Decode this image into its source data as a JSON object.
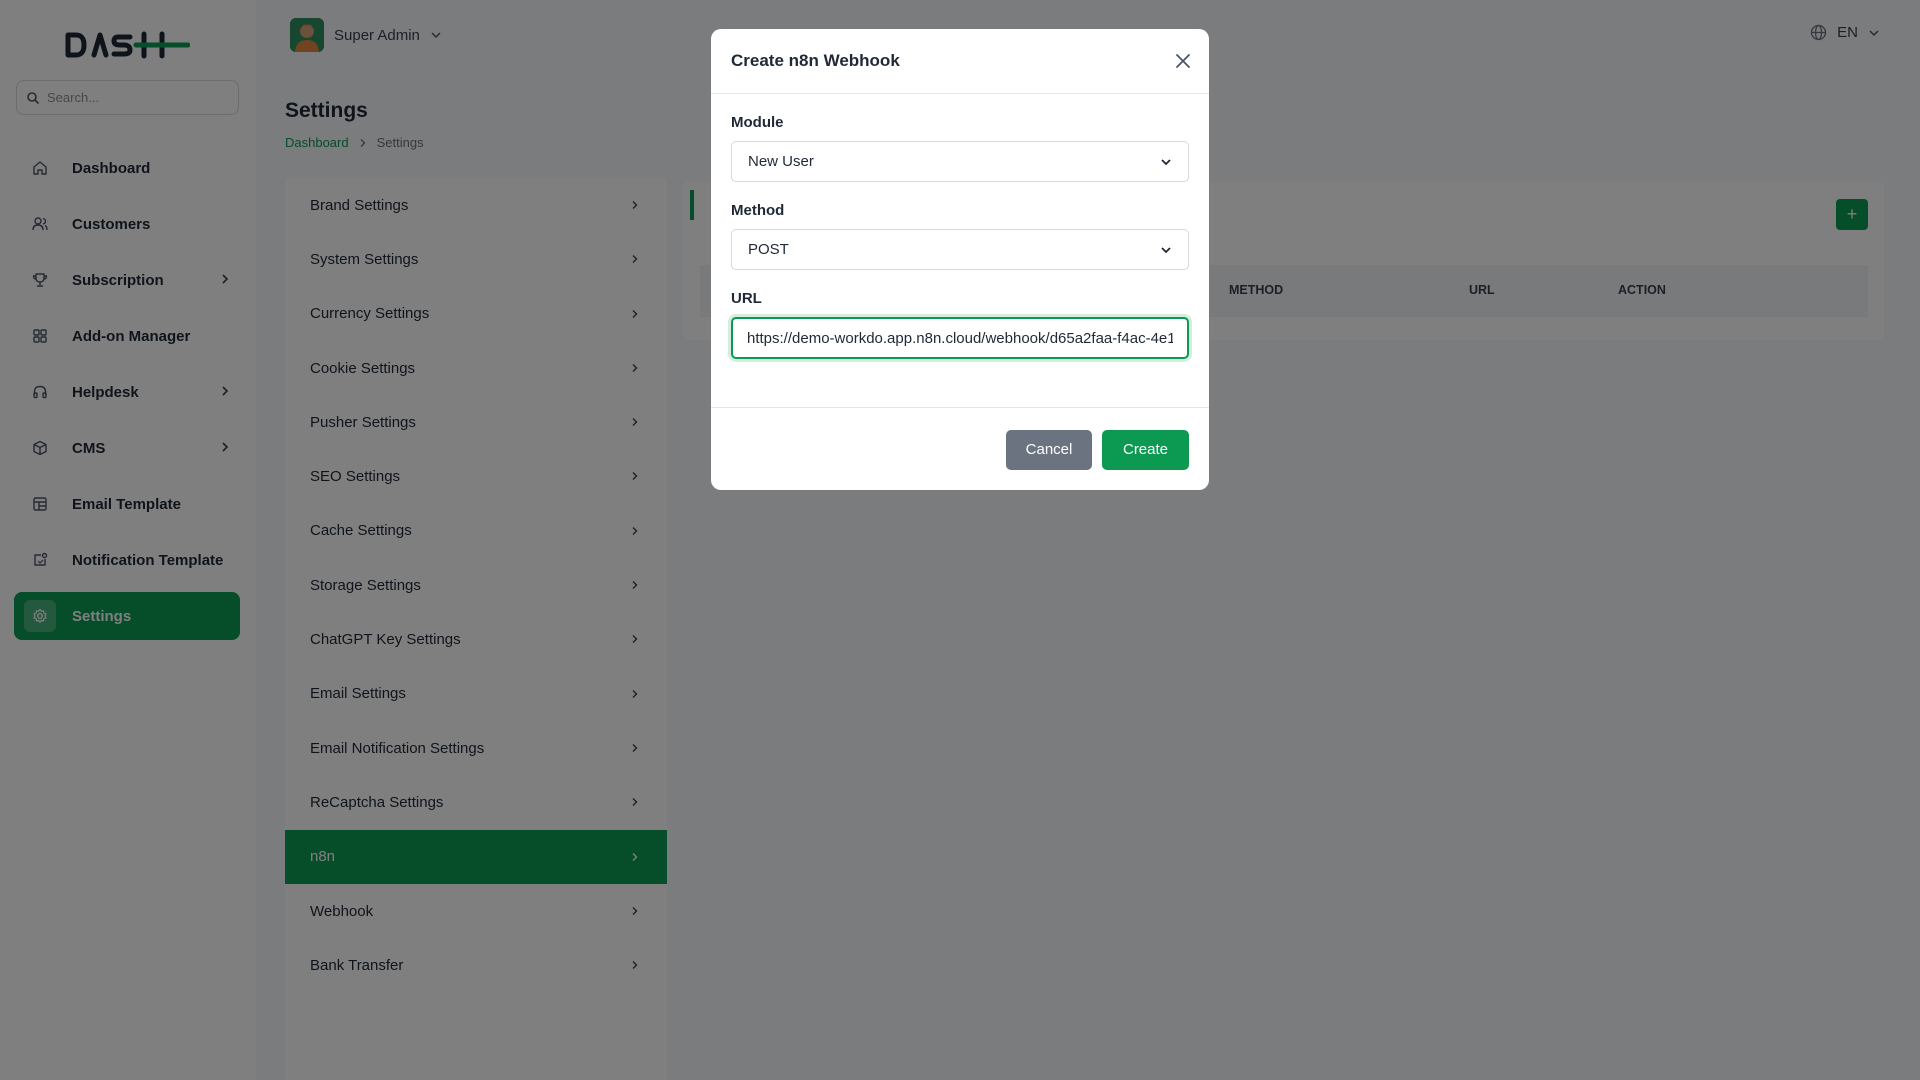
{
  "app": {
    "logo_text": "DASH"
  },
  "search": {
    "placeholder": "Search..."
  },
  "sidebar": {
    "items": [
      {
        "label": "Dashboard",
        "icon": "home-icon",
        "has_children": false,
        "active": false
      },
      {
        "label": "Customers",
        "icon": "users-icon",
        "has_children": false,
        "active": false
      },
      {
        "label": "Subscription",
        "icon": "trophy-icon",
        "has_children": true,
        "active": false
      },
      {
        "label": "Add-on Manager",
        "icon": "grid-icon",
        "has_children": false,
        "active": false
      },
      {
        "label": "Helpdesk",
        "icon": "headphones-icon",
        "has_children": true,
        "active": false
      },
      {
        "label": "CMS",
        "icon": "box-icon",
        "has_children": true,
        "active": false
      },
      {
        "label": "Email Template",
        "icon": "template-icon",
        "has_children": false,
        "active": false
      },
      {
        "label": "Notification Template",
        "icon": "notification-icon",
        "has_children": false,
        "active": false
      },
      {
        "label": "Settings",
        "icon": "gear-icon",
        "has_children": false,
        "active": true
      }
    ]
  },
  "header": {
    "user_name": "Super Admin",
    "language": "EN"
  },
  "page": {
    "title": "Settings",
    "breadcrumb": {
      "link": "Dashboard",
      "current": "Settings"
    }
  },
  "settings_menu": {
    "items": [
      {
        "label": "Brand Settings",
        "active": false
      },
      {
        "label": "System Settings",
        "active": false
      },
      {
        "label": "Currency Settings",
        "active": false
      },
      {
        "label": "Cookie Settings",
        "active": false
      },
      {
        "label": "Pusher Settings",
        "active": false
      },
      {
        "label": "SEO Settings",
        "active": false
      },
      {
        "label": "Cache Settings",
        "active": false
      },
      {
        "label": "Storage Settings",
        "active": false
      },
      {
        "label": "ChatGPT Key Settings",
        "active": false
      },
      {
        "label": "Email Settings",
        "active": false
      },
      {
        "label": "Email Notification Settings",
        "active": false
      },
      {
        "label": "ReCaptcha Settings",
        "active": false
      },
      {
        "label": "n8n",
        "active": true
      },
      {
        "label": "Webhook",
        "active": false
      },
      {
        "label": "Bank Transfer",
        "active": false
      }
    ]
  },
  "table": {
    "add_label": "+",
    "columns": [
      "METHOD",
      "URL",
      "ACTION"
    ]
  },
  "modal": {
    "title": "Create n8n Webhook",
    "module_label": "Module",
    "module_value": "New User",
    "method_label": "Method",
    "method_value": "POST",
    "url_label": "URL",
    "url_value": "https://demo-workdo.app.n8n.cloud/webhook/d65a2faa-f4ac-4e1",
    "cancel_label": "Cancel",
    "create_label": "Create"
  },
  "colors": {
    "accent": "#0c9a53",
    "cancel": "#6b7280"
  }
}
